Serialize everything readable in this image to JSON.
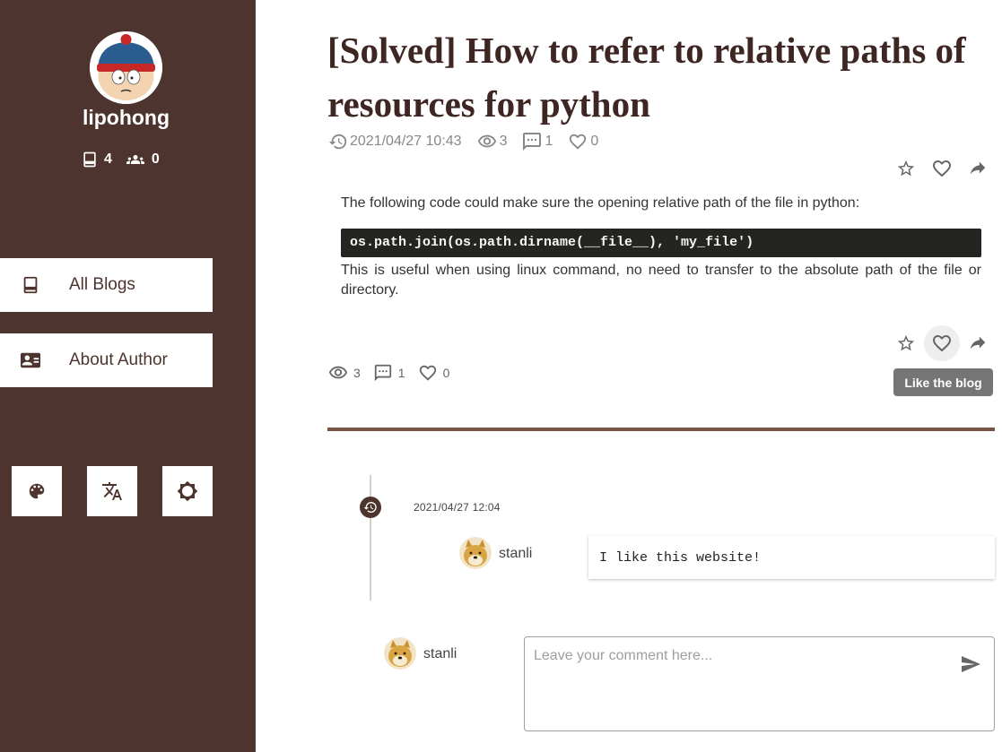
{
  "sidebar": {
    "username": "lipohong",
    "stats": {
      "blogs": "4",
      "followers": "0"
    },
    "nav": [
      {
        "label": "All Blogs",
        "icon": "book-icon"
      },
      {
        "label": "About Author",
        "icon": "id-card-icon"
      }
    ],
    "tools": [
      "palette-icon",
      "translate-icon",
      "brightness-icon"
    ]
  },
  "post": {
    "title": "[Solved] How to refer to relative paths of resources for python",
    "datetime": "2021/04/27 10:43",
    "views": "3",
    "comments": "1",
    "likes": "0",
    "paragraph1": "The following code could make sure the opening relative path of the file in python:",
    "code": "os.path.join(os.path.dirname(__file__), 'my_file')",
    "paragraph2": "This is useful when using linux command, no need to transfer to the absolute path of the file or directory."
  },
  "bottom_stats": {
    "views": "3",
    "comments": "1",
    "likes": "0"
  },
  "tooltip": "Like the blog",
  "comment": {
    "date": "2021/04/27 12:04",
    "author": "stanli",
    "text": "I like this website!"
  },
  "composer": {
    "author": "stanli",
    "placeholder": "Leave your comment here..."
  },
  "colors": {
    "sidebar_bg": "#4e342e",
    "accent": "#795548",
    "code_bg": "#242520"
  }
}
